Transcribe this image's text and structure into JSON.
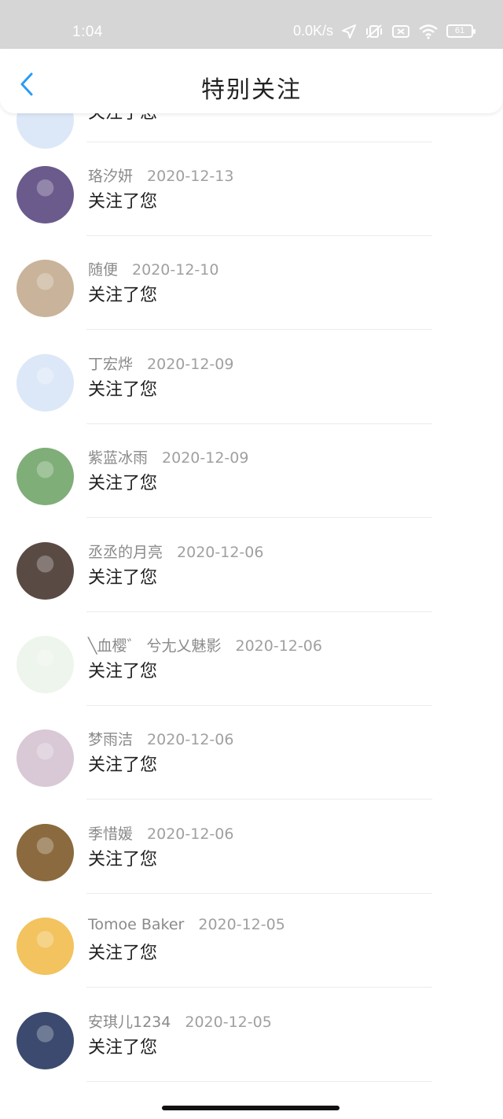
{
  "status_bar": {
    "time": "1:04",
    "net_speed": "0.0K/s",
    "battery": "61"
  },
  "header": {
    "title": "特别关注"
  },
  "list": {
    "partial_top": {
      "action": "关注了您"
    },
    "items": [
      {
        "name": "珞汐妍",
        "date": "2020-12-13",
        "action": "关注了您",
        "avatar_color": "#6b5a8c"
      },
      {
        "name": "随便",
        "date": "2020-12-10",
        "action": "关注了您",
        "avatar_color": "#c9b39a"
      },
      {
        "name": "丁宏烨",
        "date": "2020-12-09",
        "action": "关注了您",
        "avatar_color": "#dce8f7"
      },
      {
        "name": "紫蓝冰雨",
        "date": "2020-12-09",
        "action": "关注了您",
        "avatar_color": "#7fae78"
      },
      {
        "name": "丞丞的月亮",
        "date": "2020-12-06",
        "action": "关注了您",
        "avatar_color": "#5a4a44"
      },
      {
        "name": "╲血樱゛ 兮尢乂魅影",
        "date": "2020-12-06",
        "action": "关注了您",
        "avatar_color": "#eef5ec"
      },
      {
        "name": "梦雨洁",
        "date": "2020-12-06",
        "action": "关注了您",
        "avatar_color": "#d9c8d6"
      },
      {
        "name": "季惜媛",
        "date": "2020-12-06",
        "action": "关注了您",
        "avatar_color": "#8a6a3e"
      },
      {
        "name": "Tomoe Baker",
        "date": "2020-12-05",
        "action": "关注了您",
        "avatar_color": "#f2c35e"
      },
      {
        "name": "安琪儿1234",
        "date": "2020-12-05",
        "action": "关注了您",
        "avatar_color": "#3b4a6e"
      }
    ]
  }
}
